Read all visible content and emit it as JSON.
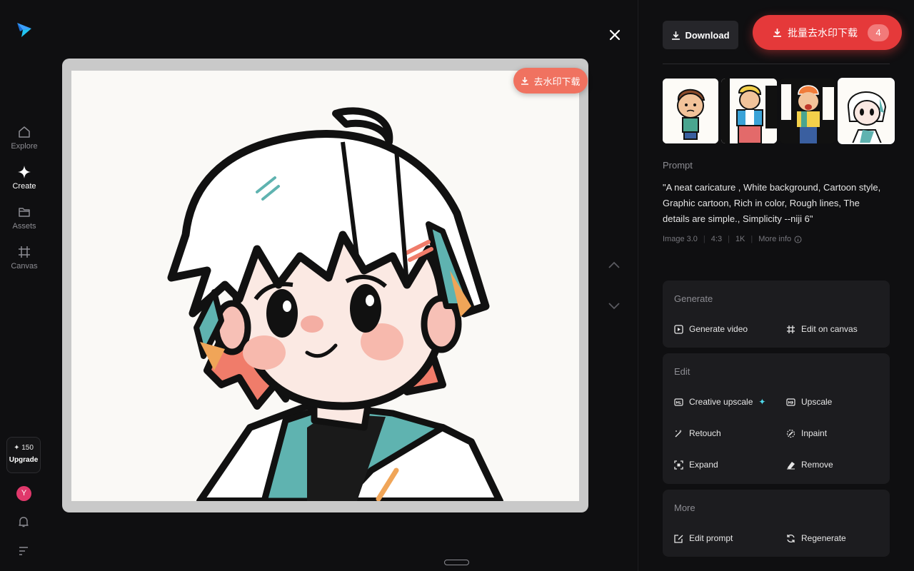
{
  "sidebar": {
    "logo_icon": "app-logo-icon",
    "items": [
      {
        "label": "Explore",
        "icon": "home-icon"
      },
      {
        "label": "Create",
        "icon": "sparkle-icon"
      },
      {
        "label": "Assets",
        "icon": "folder-icon"
      },
      {
        "label": "Canvas",
        "icon": "canvas-icon"
      }
    ],
    "credits": "✦ 150",
    "upgrade": "Upgrade",
    "avatar": "Y"
  },
  "viewer": {
    "watermark_button": "去水印下载"
  },
  "panel": {
    "download": "Download",
    "batch": "批量去水印下载",
    "batch_count": "4",
    "prompt_label": "Prompt",
    "prompt_text": "\"A neat caricature , White background, Cartoon style, Graphic cartoon, Rich in color, Rough lines, The details are simple., Simplicity --niji 6\"",
    "meta": {
      "model": "Image 3.0",
      "ratio": "4:3",
      "resolution": "1K",
      "more": "More info"
    },
    "generate": {
      "title": "Generate",
      "video": "Generate video",
      "canvas": "Edit on canvas"
    },
    "edit": {
      "title": "Edit",
      "creative": "Creative upscale",
      "upscale": "Upscale",
      "retouch": "Retouch",
      "inpaint": "Inpaint",
      "expand": "Expand",
      "remove": "Remove"
    },
    "more": {
      "title": "More",
      "edit_prompt": "Edit prompt",
      "regenerate": "Regenerate"
    }
  },
  "colors": {
    "accent_red": "#e5393a",
    "watermark_btn": "#f07260",
    "avatar": "#e0386b",
    "sparkle": "#4fd8ea"
  }
}
